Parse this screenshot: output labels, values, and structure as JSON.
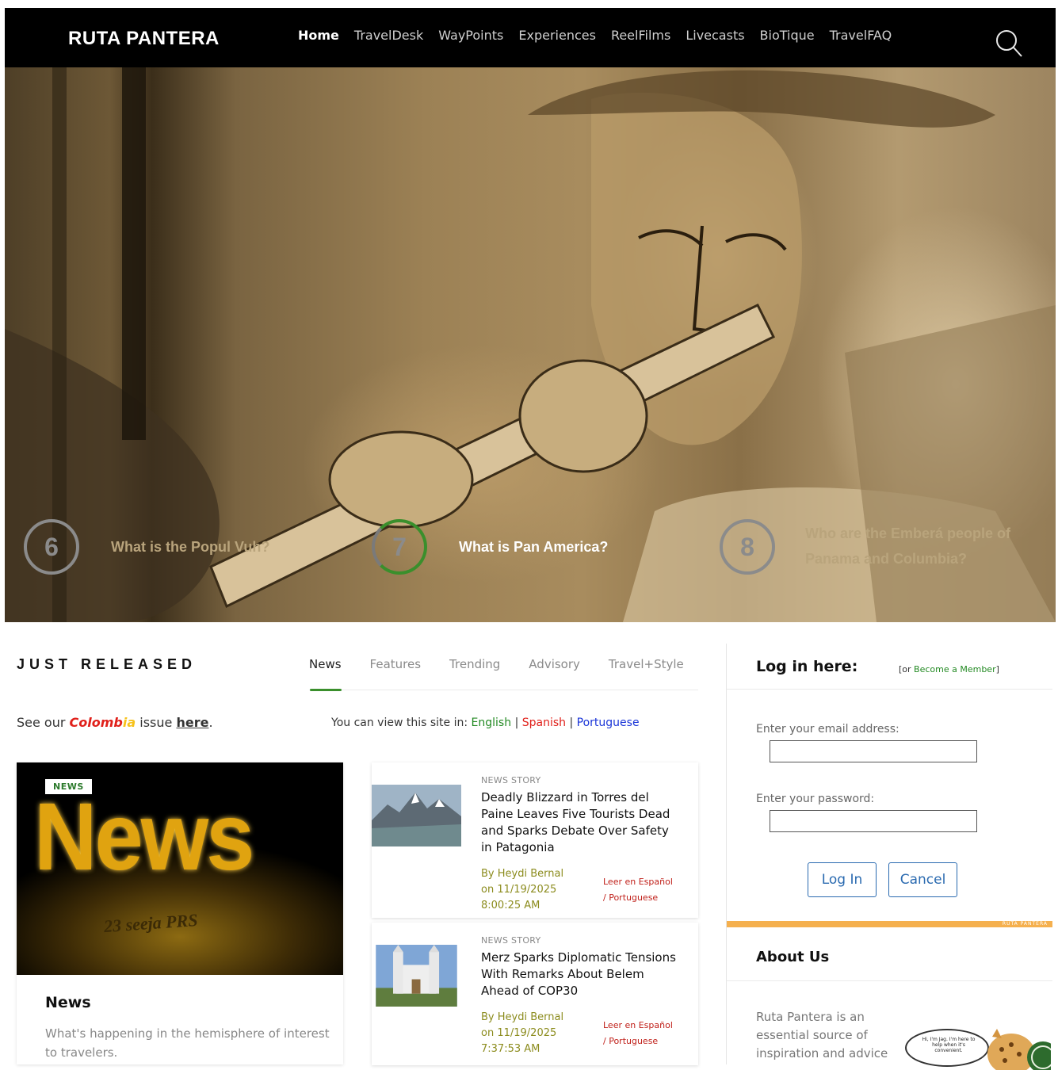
{
  "header": {
    "logo": "RUTA PANTERA",
    "nav": [
      {
        "label": "Home",
        "active": true
      },
      {
        "label": "TravelDesk"
      },
      {
        "label": "WayPoints"
      },
      {
        "label": "Experiences"
      },
      {
        "label": "ReelFilms"
      },
      {
        "label": "Livecasts"
      },
      {
        "label": "BioTique"
      },
      {
        "label": "TravelFAQ"
      }
    ],
    "search_icon": "search-icon"
  },
  "hero": {
    "slides": [
      {
        "number": "6",
        "title": "What is the Popul Vuh?"
      },
      {
        "number": "7",
        "title": "What is Pan America?",
        "active": true
      },
      {
        "number": "8",
        "title": "Who are the Emberá people of Panama and Columbia?"
      }
    ]
  },
  "just_released": {
    "title": "JUST RELEASED",
    "tabs": [
      "News",
      "Features",
      "Trending",
      "Advisory",
      "Travel+Style"
    ],
    "active_tab": "News",
    "promo": {
      "prefix": "See our",
      "word_part1": "Colomb",
      "word_part2": "ia",
      "middle": "issue",
      "link": "here",
      "suffix": "."
    },
    "languages": {
      "prefix": "You can view this site in:",
      "english": "English",
      "spanish": "Spanish",
      "portuguese": "Portuguese",
      "sep": "|"
    },
    "news_card": {
      "badge": "NEWS",
      "image_word": "News",
      "image_caption": "23 seeja PRS",
      "title": "News",
      "description": "What's happening in the hemisphere of interest to travelers."
    },
    "stories": [
      {
        "kind": "NEWS STORY",
        "title": "Deadly Blizzard in Torres del Paine Leaves Five Tourists Dead and Sparks Debate Over Safety in Patagonia",
        "by": "By Heydi Bernal",
        "date": "on 11/19/2025",
        "time": "8:00:25 AM",
        "leer": "Leer en Español",
        "port": "/ Portuguese"
      },
      {
        "kind": "NEWS STORY",
        "title": "Merz Sparks Diplomatic Tensions With Remarks About Belem Ahead of COP30",
        "by": "By Heydi Bernal",
        "date": "on 11/19/2025",
        "time": "7:37:53 AM",
        "leer": "Leer en Español",
        "port": "/ Portuguese"
      }
    ]
  },
  "sidebar": {
    "login_title": "Log in here:",
    "become": {
      "open": "[or",
      "link": "Become a Member",
      "close": "]"
    },
    "email_label": "Enter your email address:",
    "email_value": "",
    "password_label": "Enter your password:",
    "password_value": "",
    "login_button": "Log In",
    "cancel_button": "Cancel",
    "divider_text": "RUTA PANTERA",
    "about_title": "About Us",
    "about_text": "Ruta Pantera is an essential source of inspiration and advice",
    "bubble_text": "Hi, I'm Jag. I'm here to help when it's convenient."
  },
  "colors": {
    "accent_green": "#3a8f2c",
    "link_blue": "#2a6ab0",
    "divider_orange": "#f5b04e",
    "spanish_red": "#e0201a"
  }
}
